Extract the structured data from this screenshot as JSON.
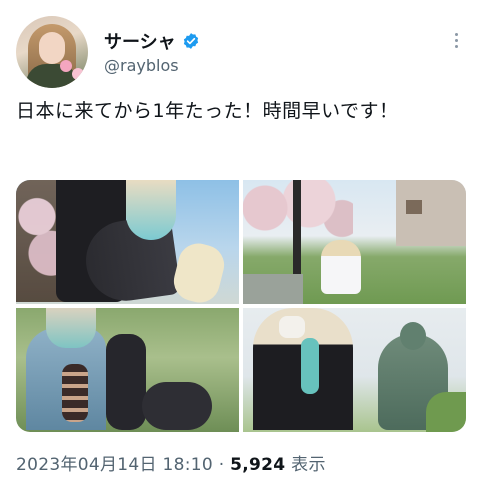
{
  "author": {
    "display_name": "サーシャ",
    "handle": "@rayblos",
    "verified": true,
    "verified_color": "#1d9bf0"
  },
  "tweet": {
    "text": "日本に来てから1年たった！時間早いです！"
  },
  "media": {
    "count": 4,
    "photos": [
      {
        "icon": "photo-cherry-blossom-sitting"
      },
      {
        "icon": "photo-park-pole"
      },
      {
        "icon": "photo-bench-greenery"
      },
      {
        "icon": "photo-great-buddha"
      }
    ]
  },
  "meta": {
    "timestamp": "2023年04月14日 18:10",
    "separator": " · ",
    "views_count": "5,924",
    "views_label": " 表示"
  },
  "colors": {
    "text_primary": "#0f1419",
    "text_secondary": "#536471",
    "accent": "#1d9bf0"
  }
}
